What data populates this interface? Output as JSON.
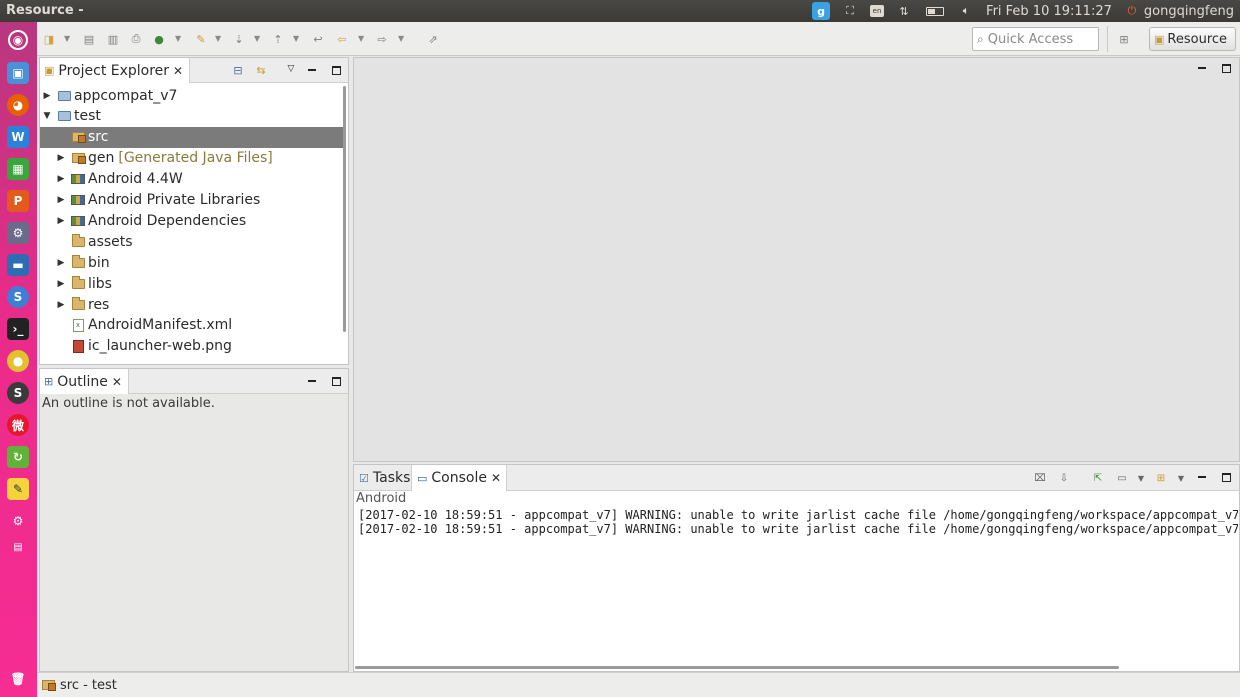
{
  "topbar": {
    "window_title": "Resource -",
    "clock": "Fri Feb 10 19:11:27",
    "user": "gongqingfeng",
    "tray_icons": [
      "input-method-icon",
      "screenshot-icon",
      "keyboard-icon",
      "network-icon",
      "battery-icon",
      "volume-icon",
      "power-icon"
    ],
    "input_method_label": "g"
  },
  "launcher": {
    "items": [
      "dash-icon",
      "files-icon",
      "firefox-icon",
      "writer-icon",
      "calc-icon",
      "impress-icon",
      "tool-icon",
      "terminal-app-icon",
      "browser-icon",
      "console-icon",
      "chrome-icon",
      "sublime-icon",
      "weibo-icon",
      "update-icon",
      "notes-icon",
      "settings-icon",
      "workspace-icon",
      "trash-icon"
    ],
    "accent": "#ea2b8a"
  },
  "toolbar": {
    "quick_access_placeholder": "Quick Access",
    "perspective_label": "Resource"
  },
  "project_explorer": {
    "tab_label": "Project Explorer",
    "items": [
      {
        "label": "appcompat_v7",
        "expanded": false,
        "icon": "project-icon"
      },
      {
        "label": "test",
        "expanded": true,
        "icon": "project-icon"
      },
      {
        "label": "src",
        "selected": true,
        "icon": "package-folder-icon"
      },
      {
        "label": "gen",
        "decoration": "[Generated Java Files]",
        "icon": "package-folder-icon"
      },
      {
        "label": "Android 4.4W",
        "icon": "library-icon"
      },
      {
        "label": "Android Private Libraries",
        "icon": "library-icon"
      },
      {
        "label": "Android Dependencies",
        "icon": "library-icon"
      },
      {
        "label": "assets",
        "icon": "folder-icon"
      },
      {
        "label": "bin",
        "icon": "folder-icon"
      },
      {
        "label": "libs",
        "icon": "folder-icon"
      },
      {
        "label": "res",
        "icon": "folder-icon"
      },
      {
        "label": "AndroidManifest.xml",
        "icon": "xml-file-icon"
      },
      {
        "label": "ic_launcher-web.png",
        "icon": "image-file-icon"
      }
    ]
  },
  "outline": {
    "tab_label": "Outline",
    "message": "An outline is not available."
  },
  "console": {
    "tabs": [
      {
        "label": "Tasks"
      },
      {
        "label": "Console",
        "active": true
      }
    ],
    "console_name": "Android",
    "lines": [
      "[2017-02-10 18:59:51 - appcompat_v7] WARNING: unable to write jarlist cache file /home/gongqingfeng/workspace/appcompat_v7",
      "[2017-02-10 18:59:51 - appcompat_v7] WARNING: unable to write jarlist cache file /home/gongqingfeng/workspace/appcompat_v7"
    ]
  },
  "statusbar": {
    "text": "src - test"
  }
}
